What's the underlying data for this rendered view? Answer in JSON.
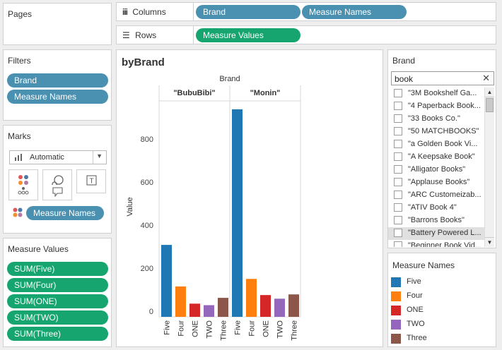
{
  "pages": {
    "title": "Pages"
  },
  "columns": {
    "label": "Columns",
    "pills": [
      "Brand",
      "Measure Names"
    ]
  },
  "rows": {
    "label": "Rows",
    "pills": [
      "Measure Values"
    ]
  },
  "filters": {
    "title": "Filters",
    "pills": [
      "Brand",
      "Measure Names"
    ]
  },
  "marks": {
    "title": "Marks",
    "mark_type": "Automatic",
    "color_pill": "Measure Names"
  },
  "measure_values": {
    "title": "Measure Values",
    "pills": [
      "SUM(Five)",
      "SUM(Four)",
      "SUM(ONE)",
      "SUM(TWO)",
      "SUM(Three)"
    ]
  },
  "brand_filter": {
    "title": "Brand",
    "search_value": "book",
    "items": [
      "\"3M Bookshelf Ga...",
      "\"4 Paperback Book...",
      "\"33 Books Co.\"",
      "\"50 MATCHBOOKS\"",
      "\"a Golden Book Vi...",
      "\"A Keepsake Book\"",
      "\"Alligator Books\"",
      "\"Applause Books\"",
      "\"ARC Customeizab...",
      "\"ATIV Book 4\"",
      "\"Barrons Books\"",
      "\"Battery Powered L...",
      "\"Beginner Book Vid..."
    ]
  },
  "legend": {
    "title": "Measure Names",
    "items": [
      {
        "name": "Five",
        "color": "#1f77b4"
      },
      {
        "name": "Four",
        "color": "#ff7f0e"
      },
      {
        "name": "ONE",
        "color": "#d62728"
      },
      {
        "name": "TWO",
        "color": "#9467bd"
      },
      {
        "name": "Three",
        "color": "#8c564b"
      }
    ]
  },
  "chart_data": {
    "type": "bar",
    "title": "byBrand",
    "column_header": "Brand",
    "ylabel": "Value",
    "ylim": [
      0,
      1000
    ],
    "yticks": [
      0,
      200,
      400,
      600,
      800
    ],
    "panes": [
      "\"BubuBibi\"",
      "\"Monin\""
    ],
    "categories": [
      "Five",
      "Four",
      "ONE",
      "TWO",
      "Three"
    ],
    "series": [
      {
        "pane": "\"BubuBibi\"",
        "values": [
          308,
          115,
          35,
          28,
          62
        ]
      },
      {
        "pane": "\"Monin\"",
        "values": [
          938,
          150,
          75,
          58,
          78
        ]
      }
    ]
  }
}
